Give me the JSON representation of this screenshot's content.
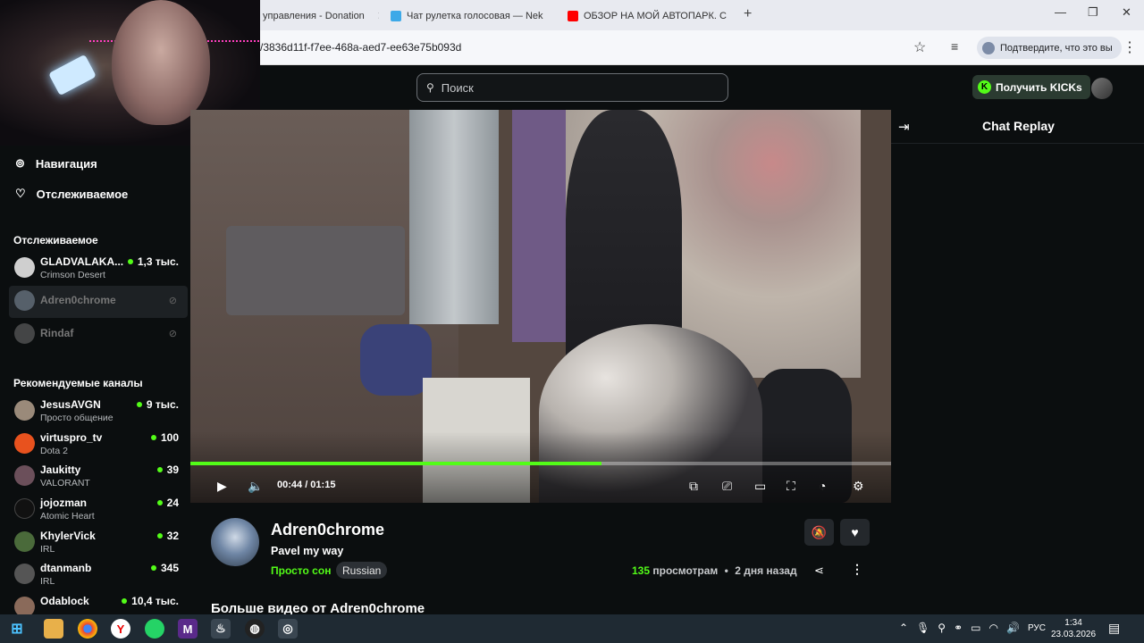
{
  "browser": {
    "tabs": [
      {
        "label": "управления - Donation",
        "icon_color": "#f0a020"
      },
      {
        "label": "Чат рулетка голосовая — Nek",
        "icon_color": "#3da9e8"
      },
      {
        "label": "ОБЗОР НА МОЙ АВТОПАРК. С",
        "icon_color": "#ff0000"
      }
    ],
    "new_tab_icon": "+",
    "url": "/3836d11f-f7ee-468a-aed7-ee63e75b093d",
    "verify_label": "Подтвердите, что это вы"
  },
  "header": {
    "search_placeholder": "Поиск",
    "get_kicks_label": "Получить KICKs"
  },
  "sidebar": {
    "nav": [
      {
        "label": "Навигация",
        "icon": "compass-icon"
      },
      {
        "label": "Отслеживаемое",
        "icon": "heart-icon"
      }
    ],
    "following_title": "Отслеживаемое",
    "following": [
      {
        "name": "GLADVALAKA...",
        "category": "Crimson Desert",
        "viewers": "1,3 тыс.",
        "avatar_color": "#cfcfcf"
      },
      {
        "name": "Adren0chrome",
        "offline": true,
        "avatar_color": "#7d8b99"
      },
      {
        "name": "Rindaf",
        "offline": true,
        "avatar_color": "#6b6b6b"
      }
    ],
    "recommended_title": "Рекомендуемые каналы",
    "recommended": [
      {
        "name": "JesusAVGN",
        "category": "Просто общение",
        "viewers": "9 тыс.",
        "avatar_color": "#9a8a7a"
      },
      {
        "name": "virtuspro_tv",
        "category": "Dota 2",
        "viewers": "100",
        "avatar_color": "#e8521e"
      },
      {
        "name": "Jaukitty",
        "category": "VALORANT",
        "viewers": "39",
        "avatar_color": "#6b4f5a"
      },
      {
        "name": "jojozman",
        "category": "Atomic Heart",
        "viewers": "24",
        "avatar_color": "#111111"
      },
      {
        "name": "KhylerVick",
        "category": "IRL",
        "viewers": "32",
        "avatar_color": "#4a6a3a"
      },
      {
        "name": "dtanmanb",
        "category": "IRL",
        "viewers": "345",
        "avatar_color": "#555555"
      },
      {
        "name": "Odablock",
        "category": "",
        "viewers": "10,4 тыс.",
        "avatar_color": "#8a6a5a"
      }
    ]
  },
  "player": {
    "current_time": "00:44",
    "duration": "01:15",
    "time_display": "00:44 / 01:15",
    "progress_fraction": 0.5867
  },
  "chat": {
    "title": "Chat Replay"
  },
  "channel": {
    "name": "Adren0chrome",
    "stream_title": "Pavel my way",
    "category": "Просто сон",
    "tag": "Russian",
    "views_count": "135",
    "views_label": "просмотрам",
    "separator": "•",
    "posted": "2 дня назад",
    "more_videos_label": "Больше видео от Adren0chrome"
  },
  "taskbar": {
    "clock_time": "1:34",
    "clock_date": "23.03.2026",
    "language": "РУС"
  },
  "colors": {
    "accent": "#53fc18",
    "background": "#0b0e0f"
  }
}
